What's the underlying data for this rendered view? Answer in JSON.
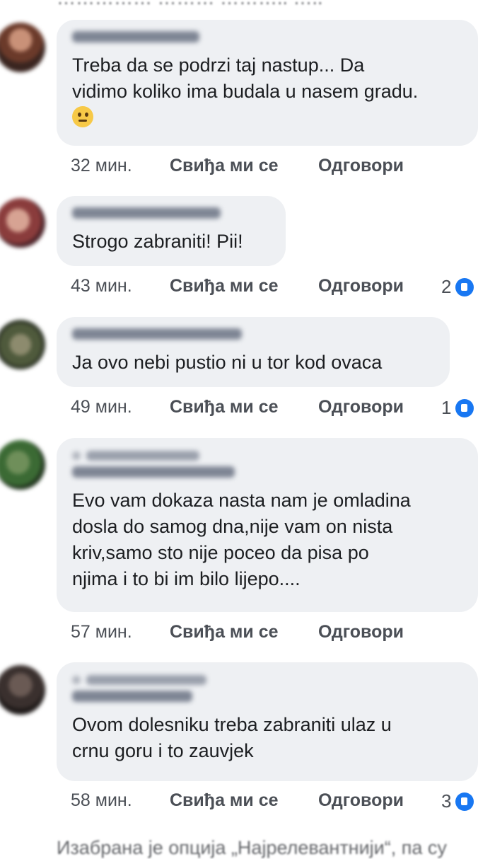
{
  "top_cut_text": "…………… ……… ……….. …..",
  "bottom_cut_text": "Изабрана је опција „Најрелевантнији“, па су",
  "actions": {
    "like": "Свиђа ми се",
    "reply": "Одговори"
  },
  "comments": [
    {
      "time": "32 мин.",
      "text": "Treba da se podrzi taj nastup... Da\nvidimo koliko ima budala u nasem gradu.",
      "emoji": "thinking-face",
      "reactions": ""
    },
    {
      "time": "43 мин.",
      "text": "Strogo zabraniti! Pii!",
      "reactions": "2"
    },
    {
      "time": "49 мин.",
      "text": "Ja ovo nebi pustio ni u tor kod ovaca",
      "reactions": "1"
    },
    {
      "time": "57 мин.",
      "text": "Evo vam dokaza nasta nam je omladina\ndosla do samog dna,nije vam on nista\nkriv,samo sto nije poceo da pisa po\nnjima i to bi im bilo lijepo....",
      "reactions": ""
    },
    {
      "time": "58 мин.",
      "text": "Ovom dolesniku treba zabraniti ulaz u\ncrnu goru i to zauvjek",
      "reactions": "3"
    }
  ],
  "colors": {
    "bubble": "#eef0f3",
    "like_blue": "#1877f2"
  }
}
